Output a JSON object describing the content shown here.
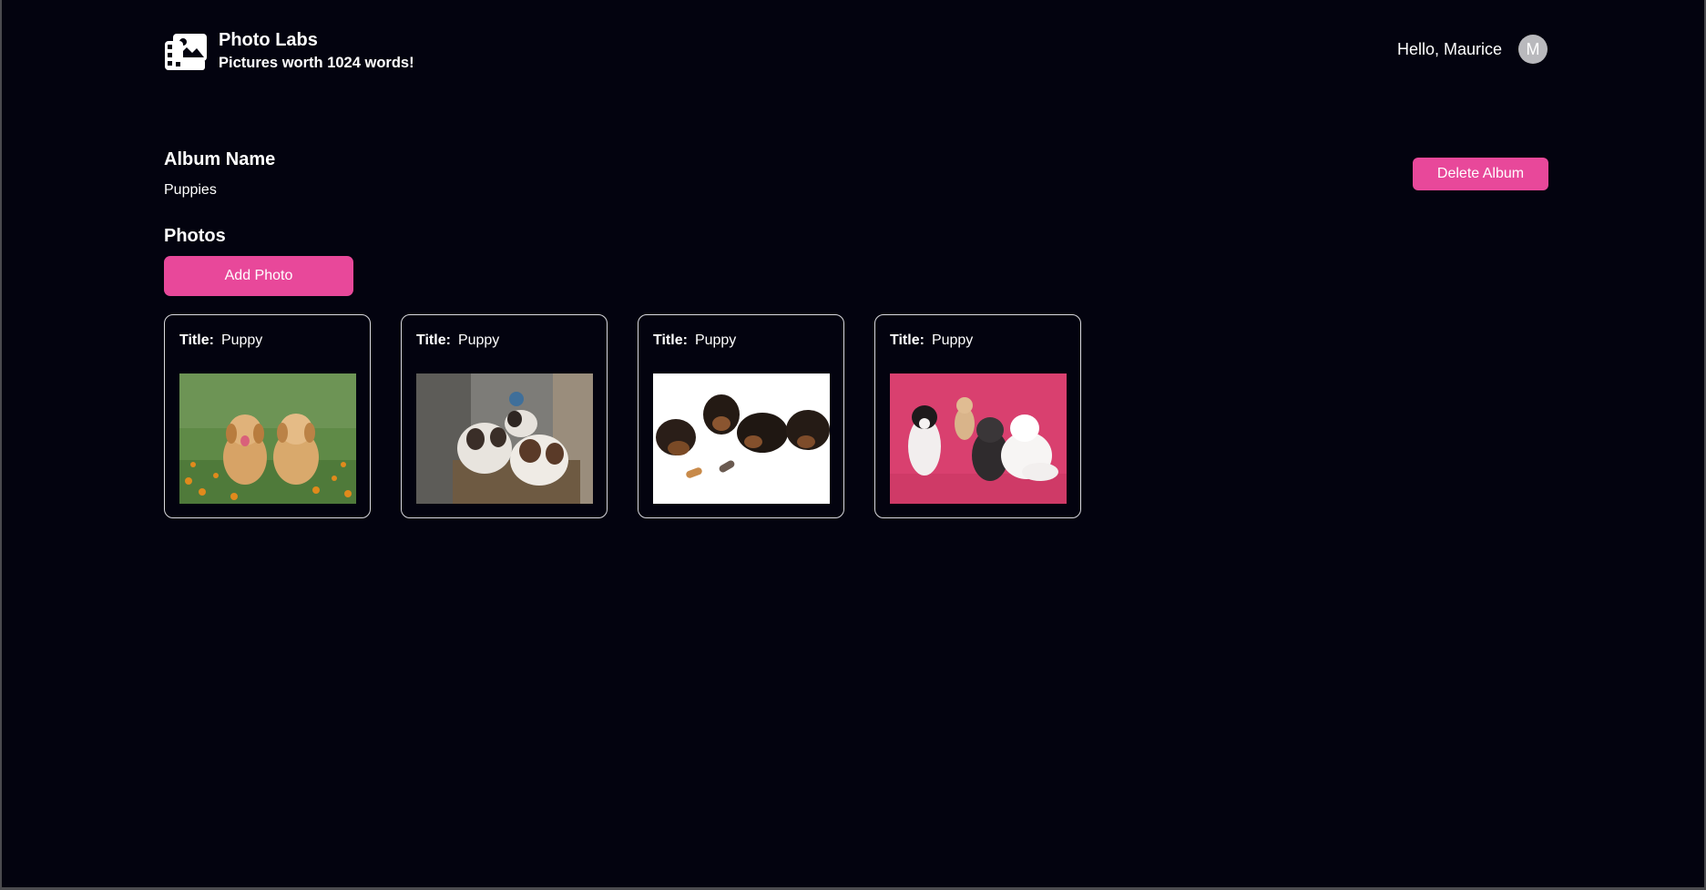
{
  "header": {
    "logo_icon": "photo-gallery-icon",
    "title": "Photo Labs",
    "tagline": "Pictures worth 1024 words!",
    "greeting": "Hello, Maurice",
    "avatar_initial": "M"
  },
  "album": {
    "name_label": "Album Name",
    "name_value": "Puppies",
    "delete_label": "Delete Album"
  },
  "photos": {
    "section_label": "Photos",
    "add_label": "Add Photo",
    "title_label": "Title:",
    "items": [
      {
        "title": "Puppy",
        "image": "golden-retriever-puppies-photo"
      },
      {
        "title": "Puppy",
        "image": "shih-tzu-puppies-photo"
      },
      {
        "title": "Puppy",
        "image": "yorkie-puppies-photo"
      },
      {
        "title": "Puppy",
        "image": "small-dogs-pink-background-photo"
      }
    ]
  },
  "colors": {
    "background": "#03030f",
    "accent": "#e8489a",
    "text": "#ffffff"
  }
}
